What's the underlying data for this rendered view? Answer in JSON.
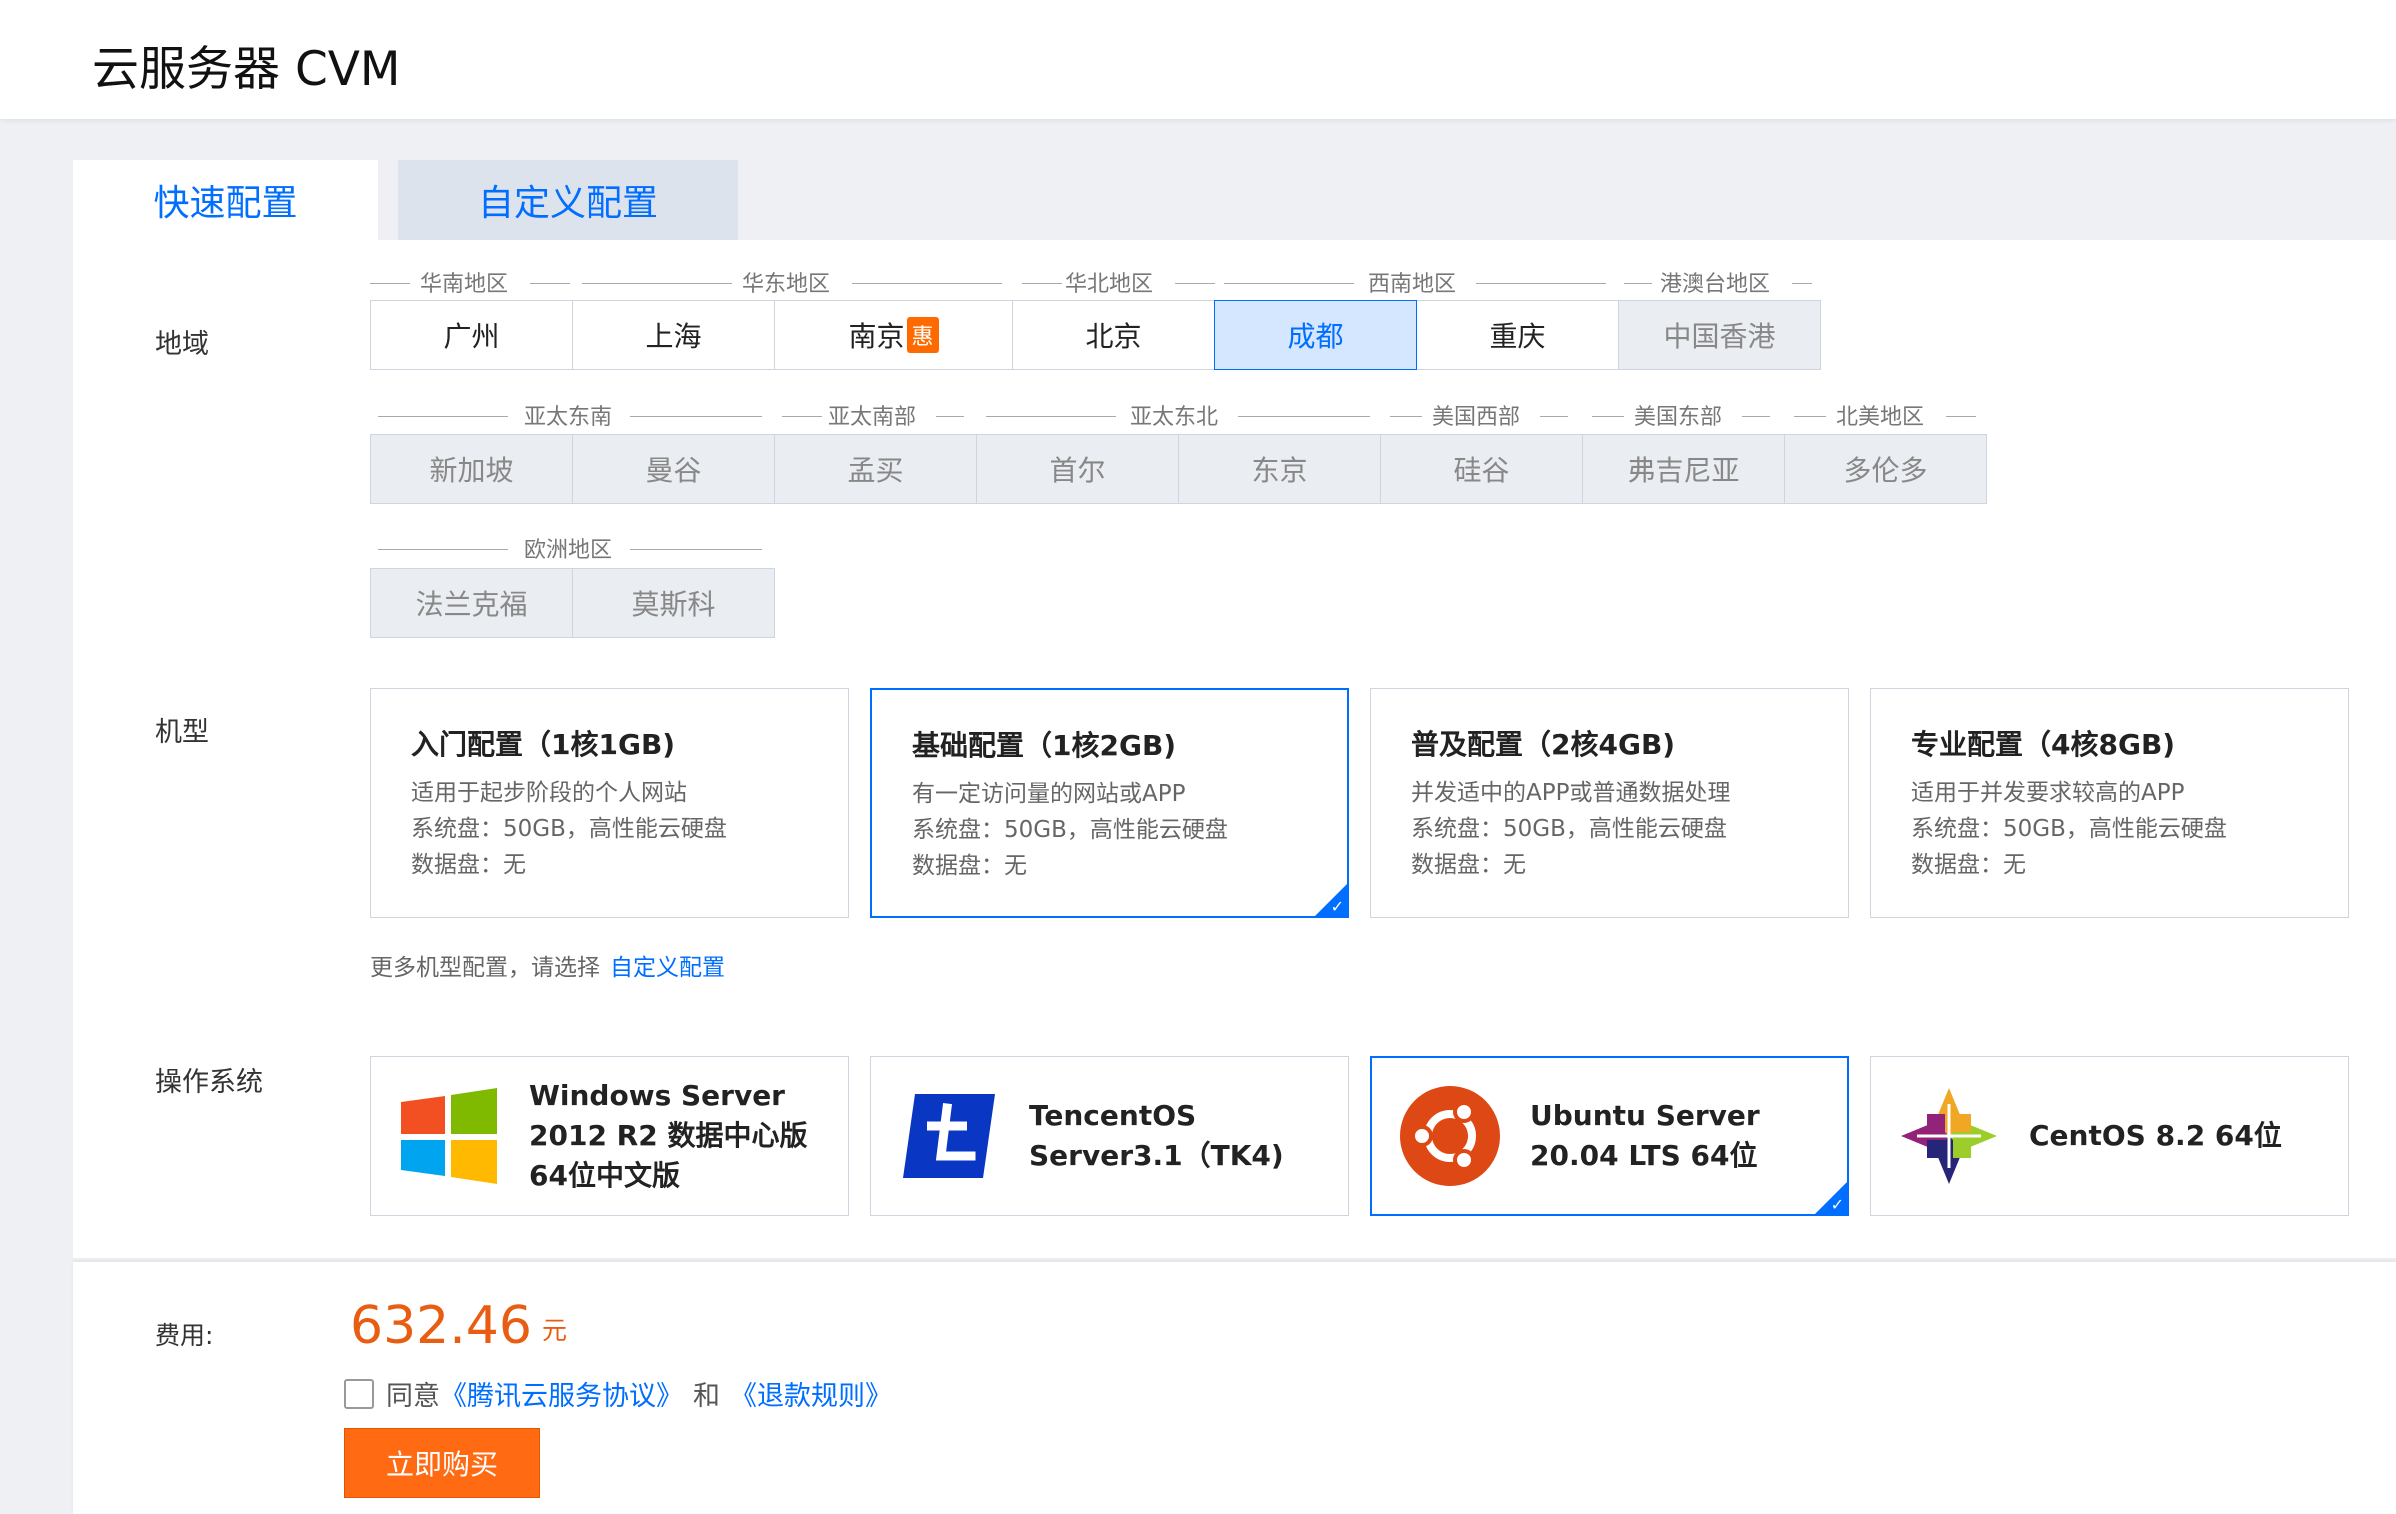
{
  "header": {
    "title": "云服务器 CVM"
  },
  "tabs": [
    {
      "label": "快速配置",
      "active": true
    },
    {
      "label": "自定义配置",
      "active": false
    }
  ],
  "region": {
    "label": "地域",
    "groups": {
      "south": "华南地区",
      "east": "华东地区",
      "north": "华北地区",
      "southwest": "西南地区",
      "hkmt": "港澳台地区",
      "se_asia": "亚太东南",
      "s_asia": "亚太南部",
      "ne_asia": "亚太东北",
      "us_west": "美国西部",
      "us_east": "美国东部",
      "na": "北美地区",
      "eu": "欧洲地区"
    },
    "row1": [
      "广州",
      "上海",
      "南京",
      "北京",
      "成都",
      "重庆",
      "中国香港"
    ],
    "nanjing_badge": "惠",
    "selected": "成都",
    "row2": [
      "新加坡",
      "曼谷",
      "孟买",
      "首尔",
      "东京",
      "硅谷",
      "弗吉尼亚",
      "多伦多"
    ],
    "row3": [
      "法兰克福",
      "莫斯科"
    ]
  },
  "model": {
    "label": "机型",
    "specs": [
      {
        "name": "入门配置（1核1GB)",
        "desc": "适用于起步阶段的个人网站",
        "system_disk": "系统盘：50GB，高性能云硬盘",
        "data_disk": "数据盘：无"
      },
      {
        "name": "基础配置（1核2GB)",
        "desc": "有一定访问量的网站或APP",
        "system_disk": "系统盘：50GB，高性能云硬盘",
        "data_disk": "数据盘：无"
      },
      {
        "name": "普及配置（2核4GB)",
        "desc": "并发适中的APP或普通数据处理",
        "system_disk": "系统盘：50GB，高性能云硬盘",
        "data_disk": "数据盘：无"
      },
      {
        "name": "专业配置（4核8GB)",
        "desc": "适用于并发要求较高的APP",
        "system_disk": "系统盘：50GB，高性能云硬盘",
        "data_disk": "数据盘：无"
      }
    ],
    "selected_index": 1,
    "more_text": "更多机型配置，请选择",
    "more_link": "自定义配置"
  },
  "os": {
    "label": "操作系统",
    "items": [
      {
        "name": "Windows Server 2012 R2 数据中心版 64位中文版",
        "icon": "windows-logo-icon"
      },
      {
        "name": "TencentOS Server3.1（TK4)",
        "icon": "tencentos-logo-icon"
      },
      {
        "name": "Ubuntu Server 20.04 LTS 64位",
        "icon": "ubuntu-logo-icon"
      },
      {
        "name": "CentOS 8.2 64位",
        "icon": "centos-logo-icon"
      }
    ],
    "selected_index": 2
  },
  "fee": {
    "label": "费用:",
    "price": "632.46",
    "unit": "元",
    "agree_prefix": "同意",
    "agreement_link": "《腾讯云服务协议》",
    "and": "和",
    "refund_link": "《退款规则》",
    "buy_label": "立即购买"
  },
  "colors": {
    "accent": "#006eff",
    "price": "#e85d11",
    "buy": "#ff6a13"
  }
}
